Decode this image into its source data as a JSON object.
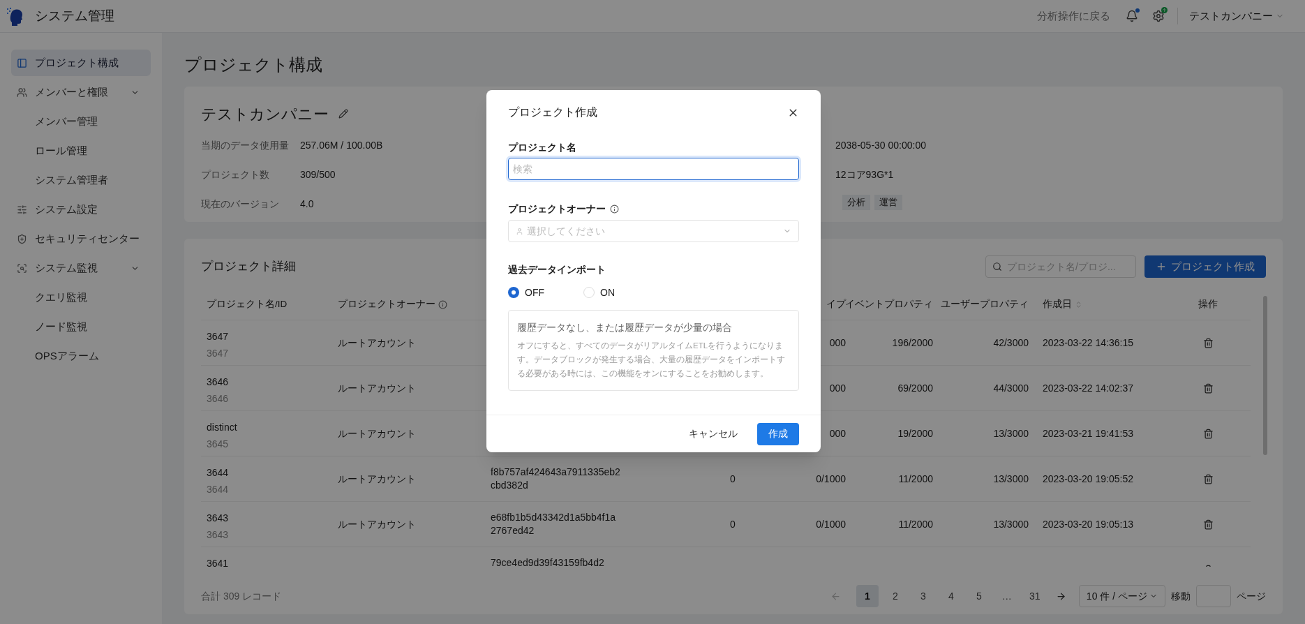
{
  "header": {
    "app_title": "システム管理",
    "back_link": "分析操作に戻る",
    "notifications": {
      "unread": true
    },
    "settings": {
      "update_badge": true
    },
    "account": "テストカンパニー"
  },
  "sidebar": {
    "items": [
      {
        "label": "プロジェクト構成",
        "selected": true
      },
      {
        "label": "メンバーと権限",
        "selected": false,
        "expanded": true,
        "children": [
          {
            "label": "メンバー管理",
            "selected": false
          },
          {
            "label": "ロール管理",
            "selected": false
          },
          {
            "label": "システム管理者",
            "selected": false
          }
        ]
      },
      {
        "label": "システム設定",
        "selected": false
      },
      {
        "label": "セキュリティセンター",
        "selected": false
      },
      {
        "label": "システム監視",
        "selected": false,
        "expanded": true,
        "children": [
          {
            "label": "クエリ監視",
            "selected": false
          },
          {
            "label": "ノード監視",
            "selected": false
          },
          {
            "label": "OPSアラーム",
            "selected": false
          }
        ]
      }
    ]
  },
  "page_title": "プロジェクト構成",
  "company_card": {
    "name": "テストカンパニー",
    "left_fields": [
      {
        "label": "当期のデータ使用量",
        "value": "257.06M / 100.00B"
      },
      {
        "label": "プロジェクト数",
        "value": "309/500"
      },
      {
        "label": "現在のバージョン",
        "value": "4.0"
      }
    ],
    "right_values": [
      "2038-05-30 00:00:00",
      "12コア93G*1"
    ],
    "tags": [
      "分析",
      "運営"
    ]
  },
  "projects": {
    "title": "プロジェクト詳細",
    "search": {
      "placeholder": "プロジェクト名/プロジ..."
    },
    "create_button": "プロジェクト作成",
    "columns": [
      {
        "label": "プロジェクト名/ID"
      },
      {
        "label": "プロジェクトオーナー",
        "info": true
      },
      {},
      {},
      {
        "label": "イプ"
      },
      {
        "label": "イベントプロパティ"
      },
      {
        "label": "ユーザープロパティ"
      },
      {
        "label": "作成日",
        "sortable": true
      },
      {
        "label": "操作"
      }
    ],
    "rows": [
      {
        "name": "3647",
        "id": "3647",
        "owner": "ルートアカウント",
        "column_3": "",
        "column_4": "",
        "column_5": "000",
        "event_props": "196/2000",
        "user_props": "42/3000",
        "created": "2023-03-22 14:36:15"
      },
      {
        "name": "3646",
        "id": "3646",
        "owner": "ルートアカウント",
        "column_3": "",
        "column_4": "",
        "column_5": "000",
        "event_props": "69/2000",
        "user_props": "44/3000",
        "created": "2023-03-22 14:02:37"
      },
      {
        "name": "distinct",
        "id": "3645",
        "owner": "ルートアカウント",
        "column_3": "",
        "column_4": "",
        "column_5": "000",
        "event_props": "19/2000",
        "user_props": "13/3000",
        "created": "2023-03-21 19:41:53"
      },
      {
        "name": "3644",
        "id": "3644",
        "owner": "ルートアカウント",
        "column_3": "f8b757af424643a7911335eb2cbd382d",
        "column_4": "0",
        "column_5": "0/1000",
        "event_props": "11/2000",
        "user_props": "13/3000",
        "created": "2023-03-20 19:05:52"
      },
      {
        "name": "3643",
        "id": "3643",
        "owner": "ルートアカウント",
        "column_3": "e68fb1b5d43342d1a5bb4f1a2767ed42",
        "column_4": "0",
        "column_5": "0/1000",
        "event_props": "11/2000",
        "user_props": "13/3000",
        "created": "2023-03-20 19:05:13"
      },
      {
        "name": "3641",
        "id": "",
        "owner": "",
        "column_3": "79ce4ed9d39f43159fb4d2",
        "column_4": "",
        "column_5": "",
        "event_props": "",
        "user_props": "",
        "created": ""
      }
    ],
    "total": "合計 309 レコード",
    "pagination": {
      "pages": [
        {
          "label": "1",
          "selected": true
        },
        {
          "label": "2",
          "selected": false
        },
        {
          "label": "3",
          "selected": false
        },
        {
          "label": "4",
          "selected": false
        },
        {
          "label": "5",
          "selected": false
        },
        {
          "label": "…",
          "selected": false
        },
        {
          "label": "31",
          "selected": false
        }
      ],
      "page_size": "10 件 / ページ",
      "jump_label": "移動",
      "jump_suffix": "ページ"
    }
  },
  "modal": {
    "title": "プロジェクト作成",
    "name_field": {
      "label": "プロジェクト名",
      "placeholder": "検索",
      "focused": true
    },
    "owner_field": {
      "label": "プロジェクトオーナー",
      "placeholder": "選択してください"
    },
    "import": {
      "label": "過去データインポート",
      "options": [
        {
          "label": "OFF",
          "selected": true
        },
        {
          "label": "ON",
          "selected": false
        }
      ],
      "info_title": "履歴データなし、または履歴データが少量の場合",
      "info_body": "オフにすると、すべてのデータがリアルタイムETLを行うようになります。データブロックが発生する場合、大量の履歴データをインポートする必要がある時には、この機能をオンにすることをお勧めします。"
    },
    "buttons": [
      {
        "label": "キャンセル",
        "kind": "secondary"
      },
      {
        "label": "作成",
        "kind": "primary"
      }
    ]
  }
}
